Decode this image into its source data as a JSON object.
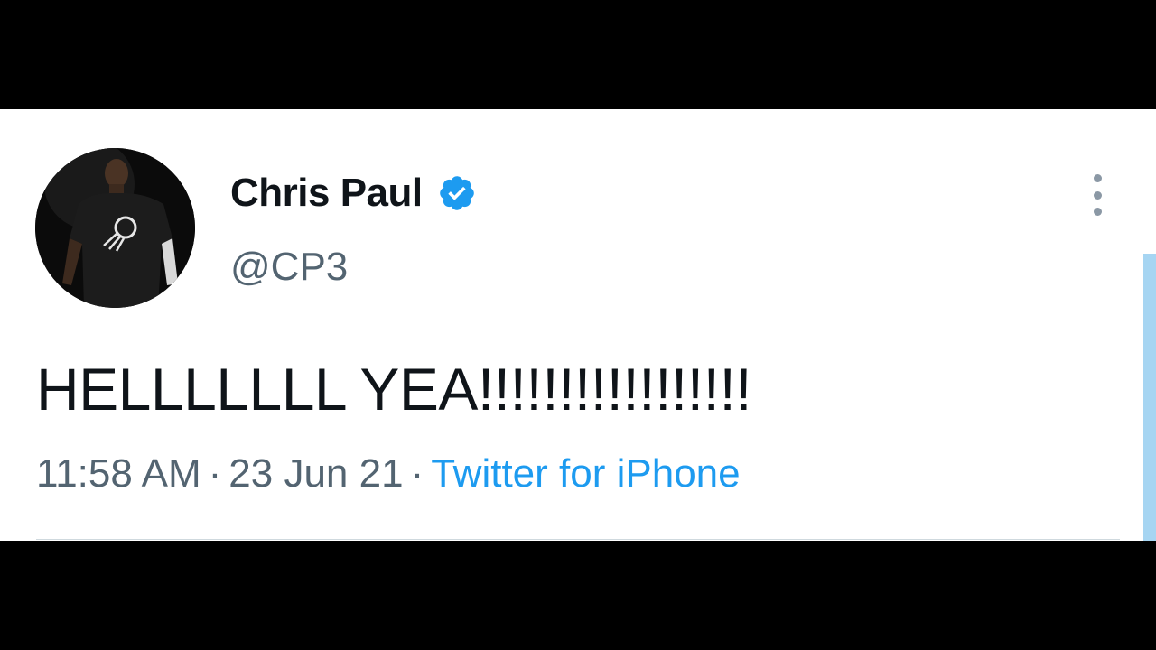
{
  "tweet": {
    "author": {
      "display_name": "Chris Paul",
      "handle": "@CP3",
      "verified": true
    },
    "text": "HELLLLLLL YEA!!!!!!!!!!!!!!!!!",
    "meta": {
      "time": "11:58 AM",
      "separator": "·",
      "date": "23 Jun 21",
      "source": "Twitter for iPhone"
    }
  },
  "colors": {
    "name": "#0f1419",
    "secondary": "#536471",
    "accent": "#1d9bf0",
    "scrollbar": "#a6d5f2"
  },
  "icons": {
    "verified": "verified-badge-icon",
    "more": "more-vertical-icon"
  }
}
